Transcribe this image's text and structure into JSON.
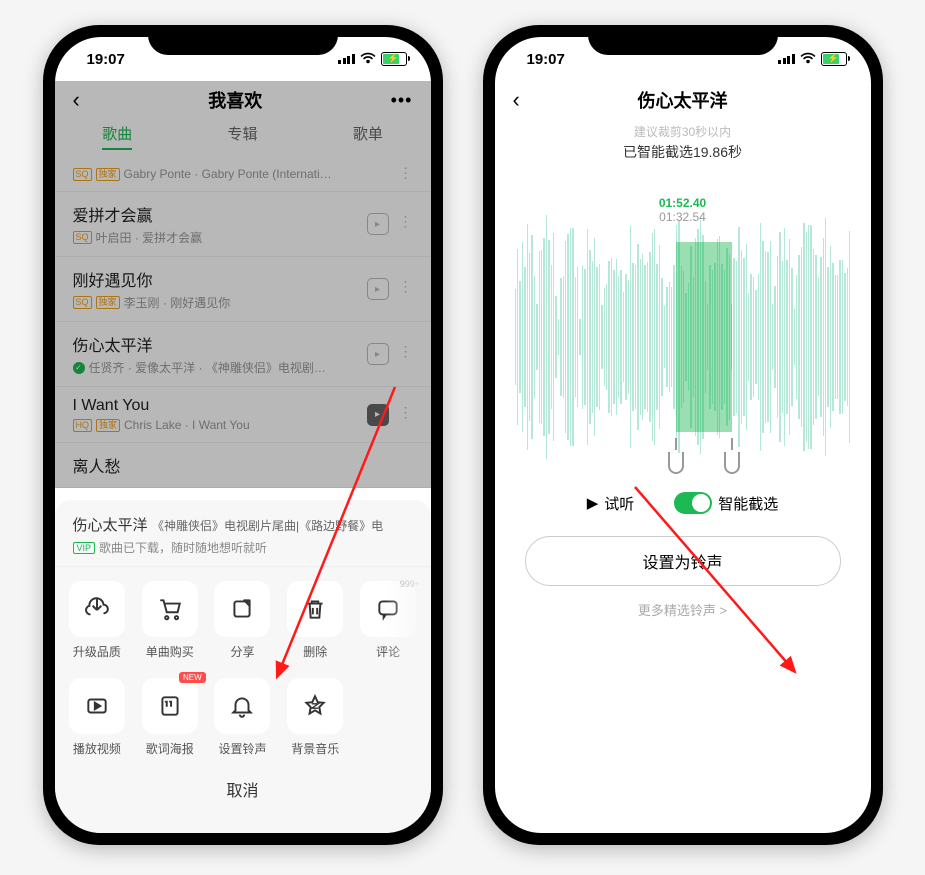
{
  "status": {
    "time": "19:07"
  },
  "phoneA": {
    "nav": {
      "title": "我喜欢"
    },
    "tabs": {
      "songs": "歌曲",
      "albums": "专辑",
      "playlists": "歌单"
    },
    "songs": [
      {
        "title": "",
        "sub": "Gabry Ponte · Gabry Ponte (Internati…",
        "badges": [
          "SQ",
          "独家"
        ]
      },
      {
        "title": "爱拼才会赢",
        "sub": "叶启田 · 爱拼才会赢",
        "badges": [
          "SQ"
        ]
      },
      {
        "title": "刚好遇见你",
        "sub": "李玉刚 · 刚好遇见你",
        "badges": [
          "SQ",
          "独家"
        ]
      },
      {
        "title": "伤心太平洋",
        "sub": "任贤齐 · 爱像太平洋 · 《神雕侠侣》电视剧…",
        "badges": [],
        "playing": true
      },
      {
        "title": "I Want You",
        "sub": "Chris Lake · I Want You",
        "badges": [
          "HQ",
          "独家"
        ]
      },
      {
        "title": "离人愁",
        "sub": "",
        "badges": []
      }
    ],
    "sheet": {
      "title": "伤心太平洋",
      "desc": "《神雕侠侣》电视剧片尾曲|《路边野餐》电",
      "note": "歌曲已下载，随时随地想听就听",
      "row1": [
        {
          "label": "升级品质",
          "icon": "upgrade"
        },
        {
          "label": "单曲购买",
          "icon": "cart"
        },
        {
          "label": "分享",
          "icon": "share"
        },
        {
          "label": "删除",
          "icon": "trash"
        },
        {
          "label": "评论",
          "icon": "comment",
          "count": "999+"
        }
      ],
      "row2": [
        {
          "label": "播放视频",
          "icon": "video"
        },
        {
          "label": "歌词海报",
          "icon": "lyrics",
          "new": "NEW"
        },
        {
          "label": "设置铃声",
          "icon": "bell"
        },
        {
          "label": "背景音乐",
          "icon": "star"
        }
      ],
      "cancel": "取消"
    }
  },
  "phoneB": {
    "title": "伤心太平洋",
    "hint": "建议裁剪30秒以内",
    "status": "已智能截选19.86秒",
    "timeTop": "01:52.40",
    "timeBottom": "01:32.54",
    "preview": "试听",
    "smartTrim": "智能截选",
    "setRingtone": "设置为铃声",
    "moreRingtones": "更多精选铃声 >"
  }
}
